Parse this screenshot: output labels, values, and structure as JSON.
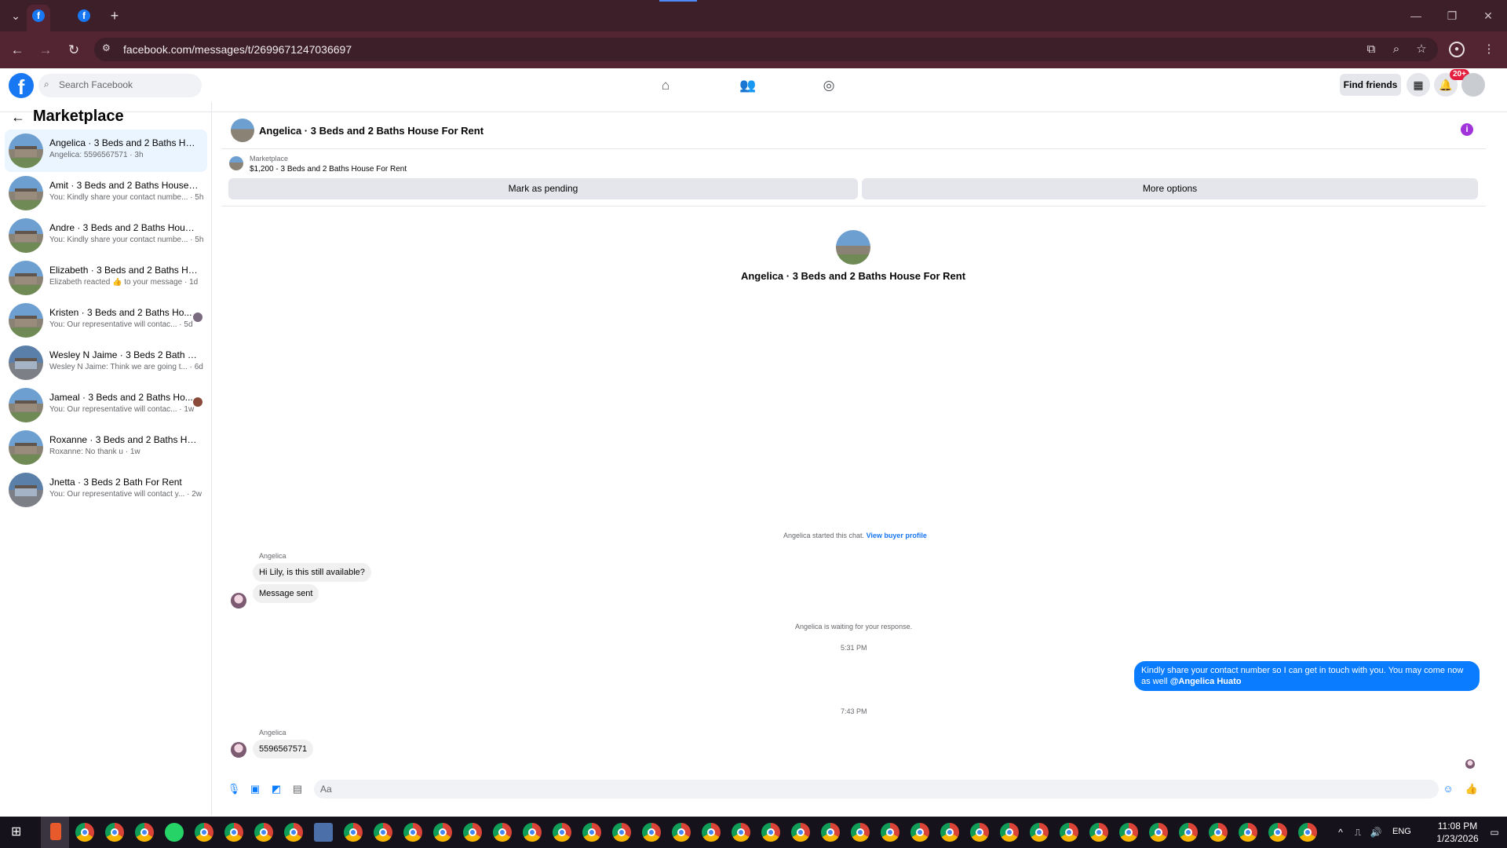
{
  "browser": {
    "url": "facebook.com/messages/t/2699671247036697",
    "new_tab_label": "+"
  },
  "header": {
    "search_placeholder": "Search Facebook",
    "find_friends_label": "Find friends",
    "notifications_badge": "20+"
  },
  "sidebar": {
    "title": "Marketplace",
    "conversations": [
      {
        "title": "Angelica · 3 Beds and 2 Baths Hou...",
        "preview": "Angelica: 5596567571 · 3h",
        "active": true
      },
      {
        "title": "Amit · 3 Beds and 2 Baths House F...",
        "preview": "You: Kindly share your contact numbe... · 5h"
      },
      {
        "title": "Andre · 3 Beds and 2 Baths House ...",
        "preview": "You: Kindly share your contact numbe... · 5h"
      },
      {
        "title": "Elizabeth · 3 Beds and 2 Baths Hou...",
        "preview": "Elizabeth reacted 👍 to your message · 1d"
      },
      {
        "title": "Kristen · 3 Beds and 2 Baths Ho...",
        "preview": "You: Our representative will contac... · 5d"
      },
      {
        "title": "Wesley N Jaime · 3 Beds 2 Bath Fo...",
        "preview": "Wesley N Jaime: Think we are going t... · 6d"
      },
      {
        "title": "Jameal · 3 Beds and 2 Baths Ho...",
        "preview": "You: Our representative will contac... · 1w"
      },
      {
        "title": "Roxanne · 3 Beds and 2 Baths Hou...",
        "preview": "Roxanne: No thank u · 1w"
      },
      {
        "title": "Jnetta · 3 Beds 2 Bath For Rent",
        "preview": "You: Our representative will contact y... · 2w"
      }
    ]
  },
  "chat": {
    "header_title": "Angelica · 3 Beds and 2 Baths House For Rent",
    "marketplace_label": "Marketplace",
    "listing": "$1,200 - 3 Beds and 2 Baths House For Rent",
    "mark_pending_label": "Mark as pending",
    "more_options_label": "More options",
    "intro_title": "Angelica · 3 Beds and 2 Baths House For Rent",
    "started_text": "Angelica started this chat.",
    "view_buyer_profile": "View buyer profile",
    "sender_name": "Angelica",
    "msg1": "Hi Lily, is this still available?",
    "msg2": "Message sent",
    "waiting_text": "Angelica is waiting for your response.",
    "time1": "5:31 PM",
    "my_message": "Kindly share your contact number so I can get in touch with you. You may come now as well",
    "mention": "@Angelica Huato",
    "time2": "7:43 PM",
    "sender_name2": "Angelica",
    "msg3": "5596567571",
    "composer_placeholder": "Aa"
  },
  "taskbar": {
    "language": "ENG",
    "time": "11:08 PM",
    "date": "1/23/2026"
  },
  "colors": {
    "facebook_blue": "#1877f2",
    "messenger_blue": "#0a7cff",
    "browser_frame": "#3c1f28",
    "notification_red": "#e41e3f"
  }
}
